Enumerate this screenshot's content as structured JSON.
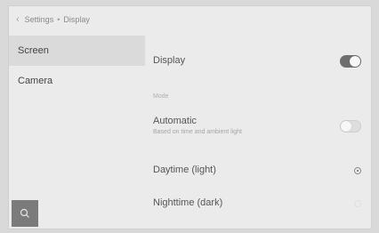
{
  "breadcrumb": {
    "back_icon": "chevron-left-icon",
    "parent": "Settings",
    "separator": "•",
    "current": "Display"
  },
  "sidebar": {
    "items": [
      {
        "label": "Screen",
        "selected": true
      },
      {
        "label": "Camera",
        "selected": false
      }
    ],
    "search_icon": "search-icon"
  },
  "main": {
    "display": {
      "label": "Display",
      "enabled": true
    },
    "mode_section": "Mode",
    "automatic": {
      "label": "Automatic",
      "description": "Based on time and ambient light",
      "enabled": false
    },
    "options": [
      {
        "label": "Daytime (light)",
        "selected": true
      },
      {
        "label": "Nighttime (dark)",
        "selected": false
      }
    ]
  },
  "colors": {
    "background": "#ebebeb",
    "toggle_on": "#6e6e6e",
    "selected_row": "#dadada",
    "search_button": "#7b7b7b"
  }
}
